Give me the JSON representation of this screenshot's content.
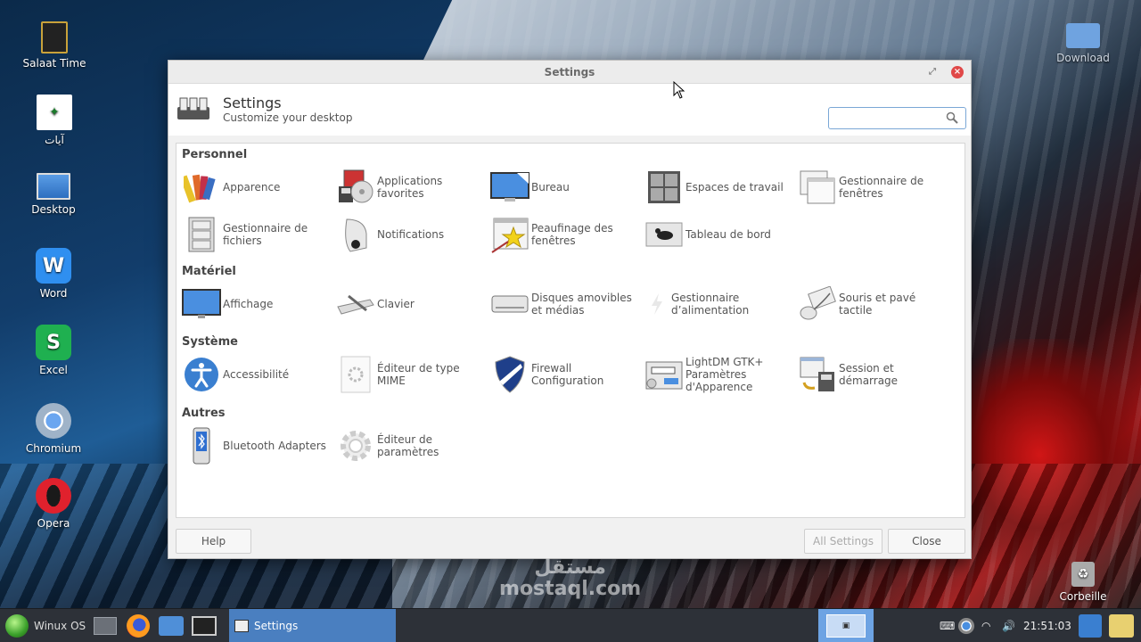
{
  "desktop": {
    "icons": [
      {
        "label": "Salaat Time",
        "icon": "kaaba-icon"
      },
      {
        "label": "آيات",
        "icon": "quran-icon"
      },
      {
        "label": "Desktop",
        "icon": "monitor-icon"
      },
      {
        "label": "Word",
        "icon": "word-icon"
      },
      {
        "label": "Excel",
        "icon": "excel-icon"
      },
      {
        "label": "Chromium",
        "icon": "chromium-icon"
      },
      {
        "label": "Opera",
        "icon": "opera-icon"
      },
      {
        "label": "Download",
        "icon": "folder-download-icon"
      },
      {
        "label": "Corbeille",
        "icon": "trash-icon"
      }
    ]
  },
  "window": {
    "title": "Settings",
    "header_title": "Settings",
    "header_subtitle": "Customize your desktop",
    "search_placeholder": ""
  },
  "sections": [
    {
      "title": "Personnel",
      "items": [
        {
          "label": "Apparence",
          "icon": "color-swatches-icon"
        },
        {
          "label": "Applications favorites",
          "icon": "preferred-applications-icon"
        },
        {
          "label": "Bureau",
          "icon": "desktop-icon"
        },
        {
          "label": "Espaces de travail",
          "icon": "workspaces-icon"
        },
        {
          "label": "Gestionnaire de fenêtres",
          "icon": "window-manager-icon"
        },
        {
          "label": "Gestionnaire de fichiers",
          "icon": "file-cabinet-icon"
        },
        {
          "label": "Notifications",
          "icon": "notifications-icon"
        },
        {
          "label": "Peaufinage des fenêtres",
          "icon": "window-tweaks-icon"
        },
        {
          "label": "Tableau de bord",
          "icon": "panel-icon"
        }
      ]
    },
    {
      "title": "Matériel",
      "items": [
        {
          "label": "Affichage",
          "icon": "display-icon"
        },
        {
          "label": "Clavier",
          "icon": "keyboard-icon"
        },
        {
          "label": "Disques amovibles et médias",
          "icon": "removable-drive-icon"
        },
        {
          "label": "Gestionnaire d’alimentation",
          "icon": "power-manager-icon"
        },
        {
          "label": "Souris et pavé tactile",
          "icon": "mouse-touchpad-icon"
        }
      ]
    },
    {
      "title": "Système",
      "items": [
        {
          "label": "Accessibilité",
          "icon": "accessibility-icon"
        },
        {
          "label": "Éditeur de type MIME",
          "icon": "mime-editor-icon"
        },
        {
          "label": "Firewall Configuration",
          "icon": "firewall-shield-icon"
        },
        {
          "label": "LightDM GTK+ Paramètres d'Apparence",
          "icon": "lightdm-login-icon"
        },
        {
          "label": "Session et démarrage",
          "icon": "session-startup-icon"
        }
      ]
    },
    {
      "title": "Autres",
      "items": [
        {
          "label": "Bluetooth Adapters",
          "icon": "bluetooth-icon"
        },
        {
          "label": "Éditeur de paramètres",
          "icon": "settings-editor-gear-icon"
        }
      ]
    }
  ],
  "footer": {
    "help_label": "Help",
    "all_settings_label": "All Settings",
    "close_label": "Close"
  },
  "taskbar": {
    "start_label": "Winux OS",
    "task_label": "Settings",
    "clock": "21:51:03"
  },
  "watermark": {
    "arabic": "مستقل",
    "latin": "mostaql.com"
  },
  "colors": {
    "accent": "#4a7fc0",
    "close_button": "#e04848",
    "taskbar": "#2d3138"
  }
}
